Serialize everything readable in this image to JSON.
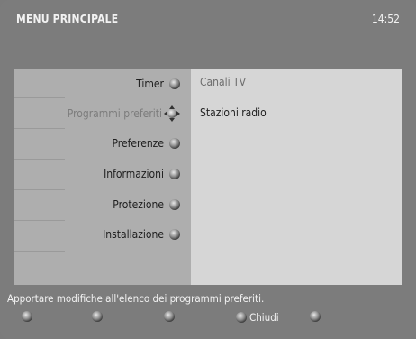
{
  "header": {
    "title": "MENU PRINCIPALE",
    "time": "14:52"
  },
  "menu": {
    "items": [
      {
        "label": "Timer",
        "icon": "round-button-icon"
      },
      {
        "label": "Programmi preferiti",
        "icon": "navigation-cross-icon",
        "active": true
      },
      {
        "label": "Preferenze",
        "icon": "round-button-icon"
      },
      {
        "label": "Informazioni",
        "icon": "round-button-icon"
      },
      {
        "label": "Protezione",
        "icon": "round-button-icon"
      },
      {
        "label": "Installazione",
        "icon": "round-button-icon"
      }
    ]
  },
  "submenu": {
    "items": [
      {
        "label": "Canali TV"
      },
      {
        "label": "Stazioni radio"
      }
    ]
  },
  "info": {
    "text": "Apportare modifiche all'elenco dei programmi preferiti."
  },
  "footer": {
    "buttons": [
      {
        "label": "",
        "icon": "red-button-icon"
      },
      {
        "label": "",
        "icon": "green-button-icon"
      },
      {
        "label": "",
        "icon": "yellow-button-icon"
      },
      {
        "label": "Chiudi",
        "icon": "blue-button-icon"
      },
      {
        "label": "",
        "icon": "option-button-icon"
      }
    ]
  }
}
